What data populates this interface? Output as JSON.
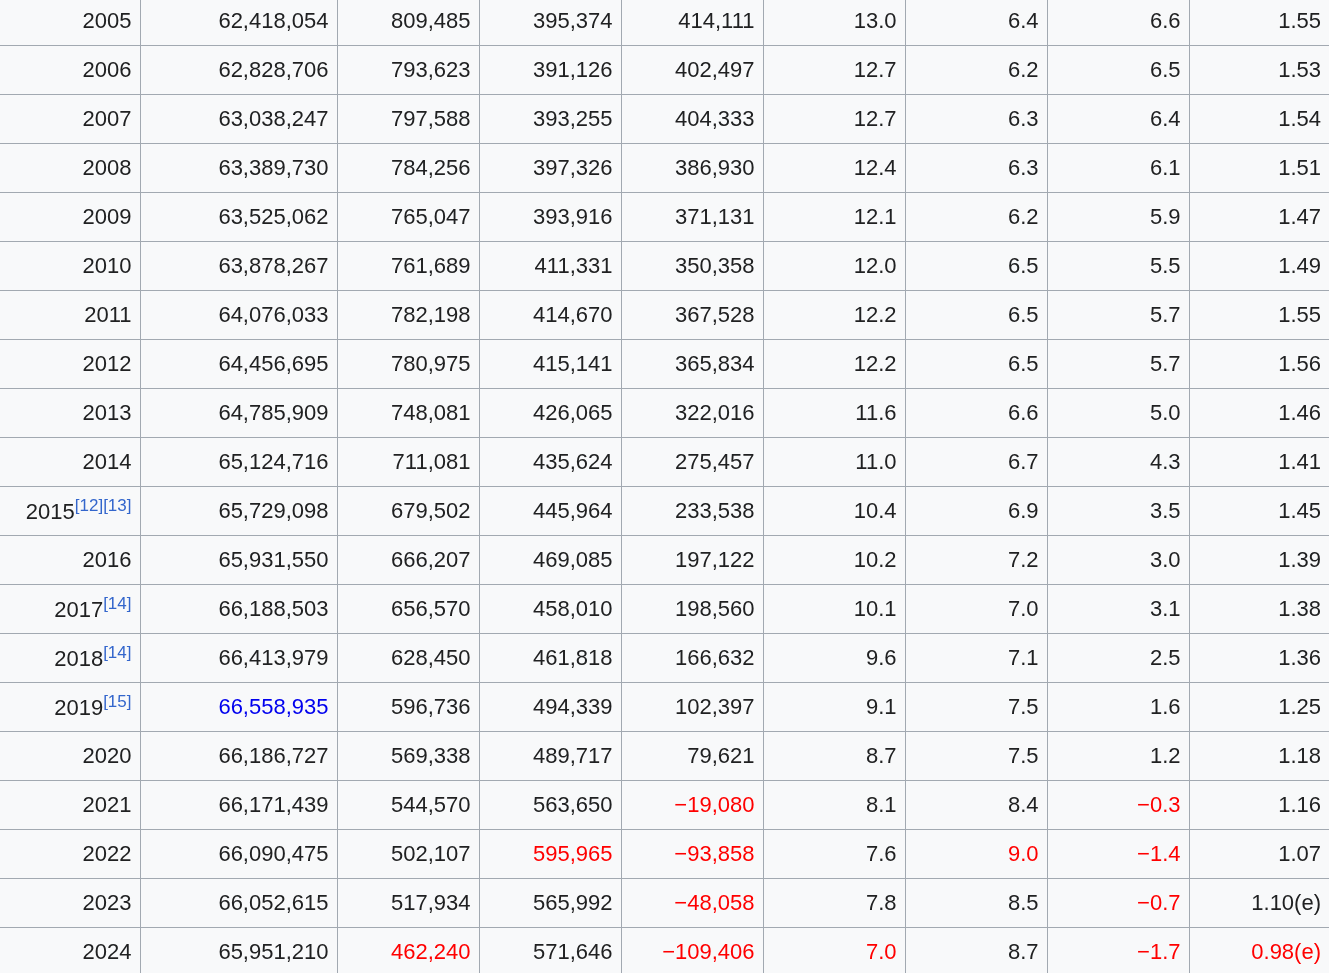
{
  "table": {
    "rows": [
      {
        "year": "2005",
        "cells": [
          "62,418,054",
          "809,485",
          "395,374",
          "414,111",
          "13.0",
          "6.4",
          "6.6",
          "1.55"
        ]
      },
      {
        "year": "2006",
        "cells": [
          "62,828,706",
          "793,623",
          "391,126",
          "402,497",
          "12.7",
          "6.2",
          "6.5",
          "1.53"
        ]
      },
      {
        "year": "2007",
        "cells": [
          "63,038,247",
          "797,588",
          "393,255",
          "404,333",
          "12.7",
          "6.3",
          "6.4",
          "1.54"
        ]
      },
      {
        "year": "2008",
        "cells": [
          "63,389,730",
          "784,256",
          "397,326",
          "386,930",
          "12.4",
          "6.3",
          "6.1",
          "1.51"
        ]
      },
      {
        "year": "2009",
        "cells": [
          "63,525,062",
          "765,047",
          "393,916",
          "371,131",
          "12.1",
          "6.2",
          "5.9",
          "1.47"
        ]
      },
      {
        "year": "2010",
        "cells": [
          "63,878,267",
          "761,689",
          "411,331",
          "350,358",
          "12.0",
          "6.5",
          "5.5",
          "1.49"
        ]
      },
      {
        "year": "2011",
        "cells": [
          "64,076,033",
          "782,198",
          "414,670",
          "367,528",
          "12.2",
          "6.5",
          "5.7",
          "1.55"
        ]
      },
      {
        "year": "2012",
        "cells": [
          "64,456,695",
          "780,975",
          "415,141",
          "365,834",
          "12.2",
          "6.5",
          "5.7",
          "1.56"
        ]
      },
      {
        "year": "2013",
        "cells": [
          "64,785,909",
          "748,081",
          "426,065",
          "322,016",
          "11.6",
          "6.6",
          "5.0",
          "1.46"
        ]
      },
      {
        "year": "2014",
        "cells": [
          "65,124,716",
          "711,081",
          "435,624",
          "275,457",
          "11.0",
          "6.7",
          "4.3",
          "1.41"
        ]
      },
      {
        "year": "2015",
        "refs": [
          "[12]",
          "[13]"
        ],
        "cells": [
          "65,729,098",
          "679,502",
          "445,964",
          "233,538",
          "10.4",
          "6.9",
          "3.5",
          "1.45"
        ]
      },
      {
        "year": "2016",
        "cells": [
          "65,931,550",
          "666,207",
          "469,085",
          "197,122",
          "10.2",
          "7.2",
          "3.0",
          "1.39"
        ]
      },
      {
        "year": "2017",
        "refs": [
          "[14]"
        ],
        "cells": [
          "66,188,503",
          "656,570",
          "458,010",
          "198,560",
          "10.1",
          "7.0",
          "3.1",
          "1.38"
        ]
      },
      {
        "year": "2018",
        "refs": [
          "[14]"
        ],
        "cells": [
          "66,413,979",
          "628,450",
          "461,818",
          "166,632",
          "9.6",
          "7.1",
          "2.5",
          "1.36"
        ]
      },
      {
        "year": "2019",
        "refs": [
          "[15]"
        ],
        "cells": [
          {
            "text": "66,558,935",
            "kind": "link"
          },
          "596,736",
          "494,339",
          "102,397",
          "9.1",
          "7.5",
          "1.6",
          "1.25"
        ]
      },
      {
        "year": "2020",
        "cells": [
          "66,186,727",
          "569,338",
          "489,717",
          "79,621",
          "8.7",
          "7.5",
          "1.2",
          "1.18"
        ]
      },
      {
        "year": "2021",
        "cells": [
          "66,171,439",
          "544,570",
          "563,650",
          {
            "text": "−19,080",
            "color": "#ff0000"
          },
          "8.1",
          "8.4",
          {
            "text": "−0.3",
            "color": "#ff0000"
          },
          "1.16"
        ]
      },
      {
        "year": "2022",
        "cells": [
          "66,090,475",
          "502,107",
          {
            "text": "595,965",
            "color": "#ff0000"
          },
          {
            "text": "−93,858",
            "color": "#ff0000"
          },
          "7.6",
          {
            "text": "9.0",
            "color": "#ff0000"
          },
          {
            "text": "−1.4",
            "color": "#ff0000"
          },
          "1.07"
        ]
      },
      {
        "year": "2023",
        "cells": [
          "66,052,615",
          "517,934",
          "565,992",
          {
            "text": "−48,058",
            "color": "#ff0000"
          },
          "7.8",
          "8.5",
          {
            "text": "−0.7",
            "color": "#ff0000"
          },
          "1.10(e)"
        ]
      },
      {
        "year": "2024",
        "cells": [
          "65,951,210",
          {
            "text": "462,240",
            "color": "#ff0000"
          },
          "571,646",
          {
            "text": "−109,406",
            "color": "#ff0000"
          },
          {
            "text": "7.0",
            "color": "#ff0000"
          },
          "8.7",
          {
            "text": "−1.7",
            "color": "#ff0000"
          },
          {
            "text": "0.98(e)",
            "color": "#ff0000"
          }
        ]
      }
    ]
  }
}
